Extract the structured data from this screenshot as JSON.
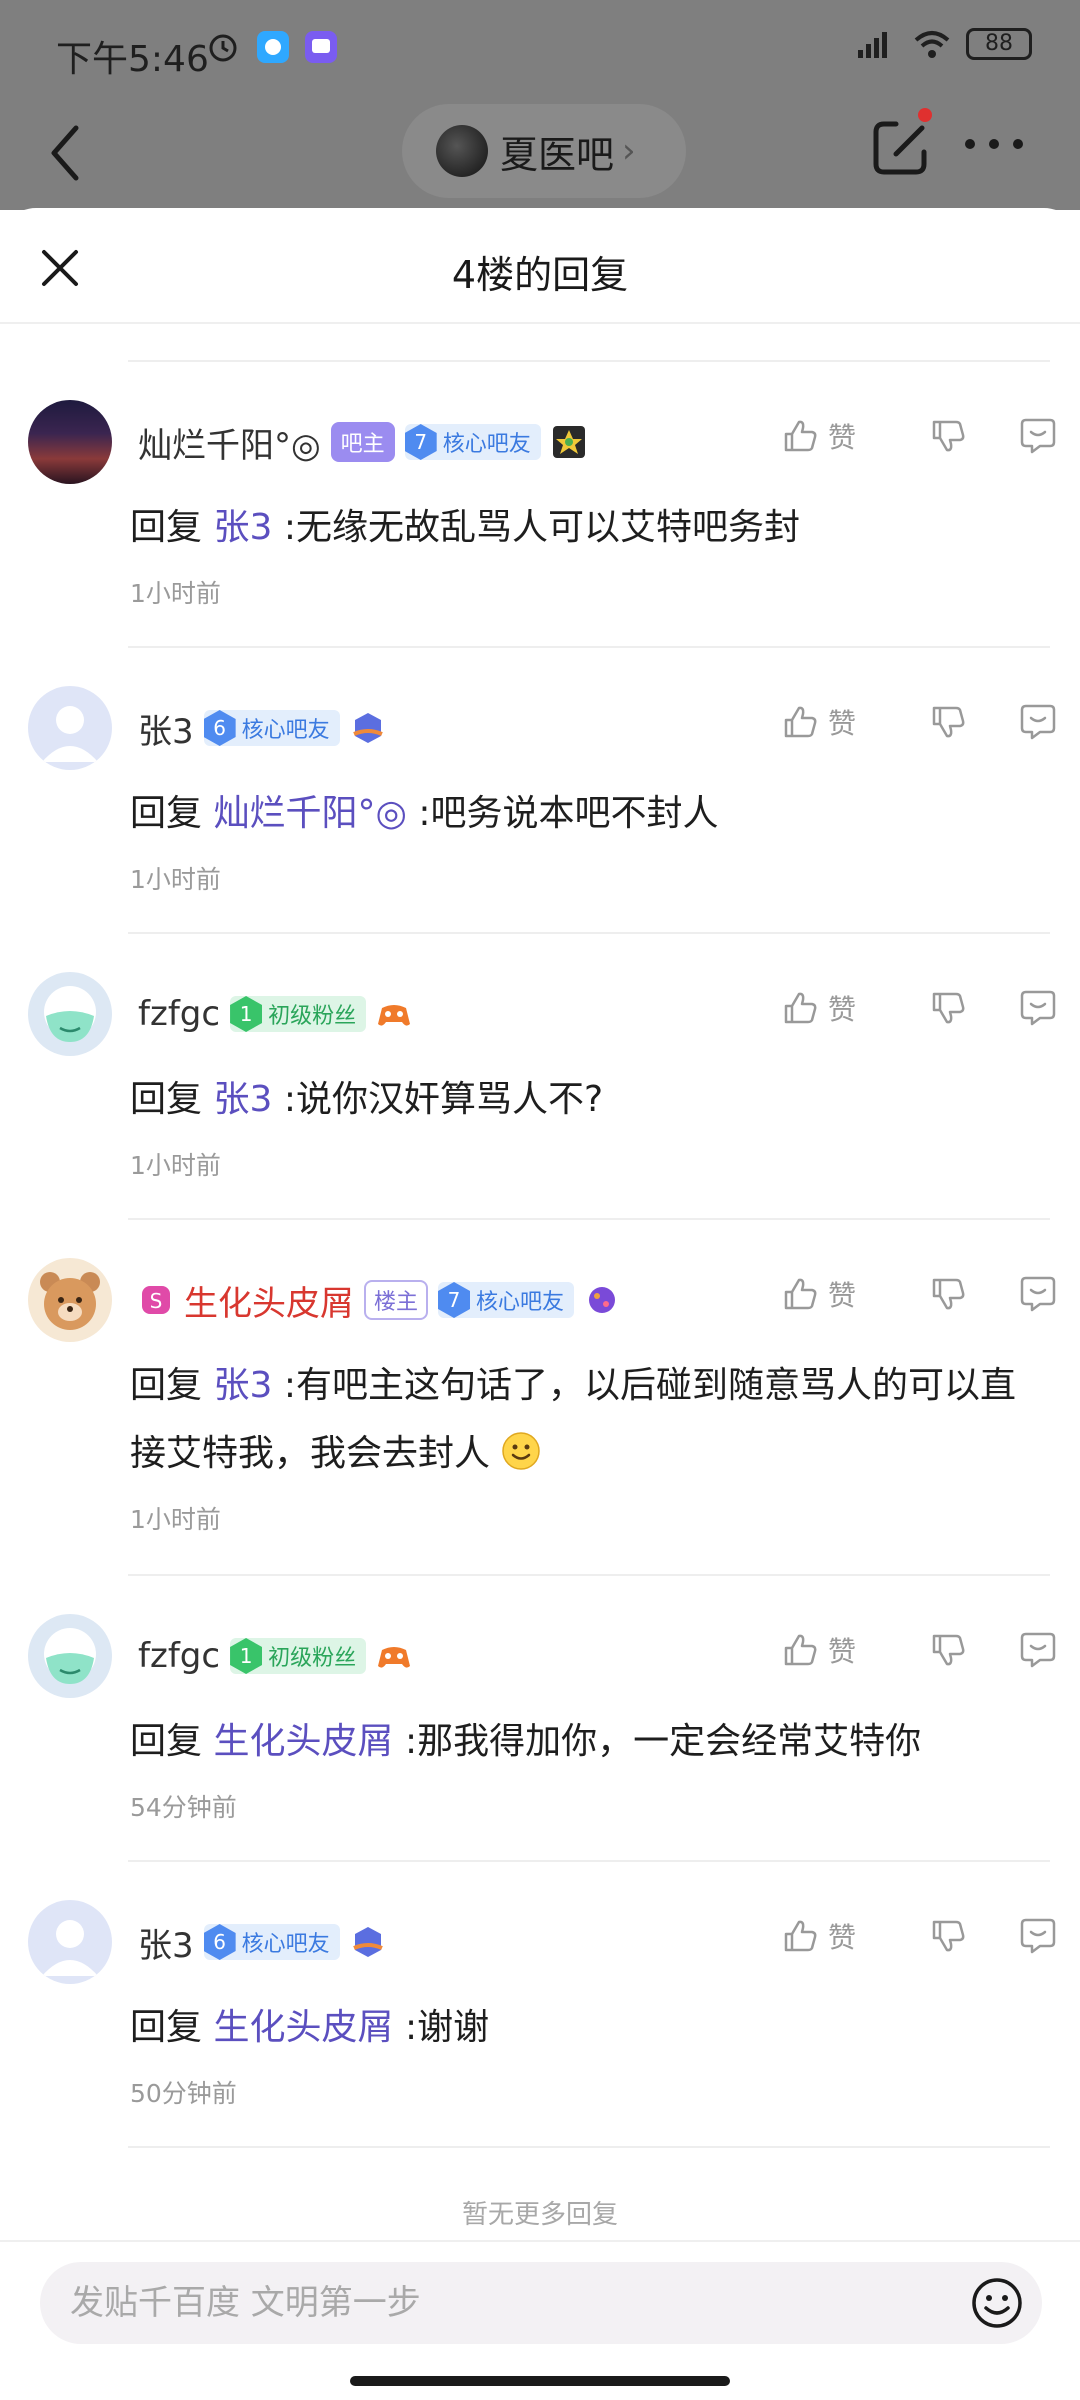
{
  "status_bar": {
    "time": "下午5:46",
    "battery": "88"
  },
  "nav": {
    "title": "夏医吧",
    "chevron": "›"
  },
  "sheet": {
    "title": "4楼的回复"
  },
  "common": {
    "like_label": "赞",
    "reply_prefix": "回复"
  },
  "replies": [
    {
      "user": "灿烂千阳°◎",
      "avatar": "sunset-avatar",
      "owner_badge": "吧主",
      "level": "7",
      "level_title": "核心吧友",
      "target": "张3",
      "text": ":无缘无故乱骂人可以艾特吧务封",
      "time": "1小时前"
    },
    {
      "user": "张3",
      "avatar": "default-avatar",
      "level": "6",
      "level_title": "核心吧友",
      "target": "灿烂千阳°◎",
      "text": ":吧务说本吧不封人",
      "time": "1小时前"
    },
    {
      "user": "fzfgc",
      "avatar": "mask-avatar",
      "level": "1",
      "level_title": "初级粉丝",
      "target": "张3",
      "text": ":说你汉奸算骂人不?",
      "time": "1小时前"
    },
    {
      "user": "生化头皮屑",
      "avatar": "bear-avatar",
      "floor_badge": "楼主",
      "level": "7",
      "level_title": "核心吧友",
      "target": "张3",
      "text": ":有吧主这句话了，以后碰到随意骂人的可以直接艾特我，我会去封人",
      "time": "1小时前"
    },
    {
      "user": "fzfgc",
      "avatar": "mask-avatar",
      "level": "1",
      "level_title": "初级粉丝",
      "target": "生化头皮屑",
      "text": ":那我得加你，一定会经常艾特你",
      "time": "54分钟前"
    },
    {
      "user": "张3",
      "avatar": "default-avatar",
      "level": "6",
      "level_title": "核心吧友",
      "target": "生化头皮屑",
      "text": ":谢谢",
      "time": "50分钟前"
    }
  ],
  "no_more": "暂无更多回复",
  "input": {
    "placeholder": "发贴千百度 文明第一步"
  },
  "colors": {
    "mention": "#5b4fbf",
    "owner_badge": "#9b8cf0",
    "level_blue": "#4f8bf0",
    "level_green": "#39c46a",
    "red_name": "#d8372f"
  }
}
